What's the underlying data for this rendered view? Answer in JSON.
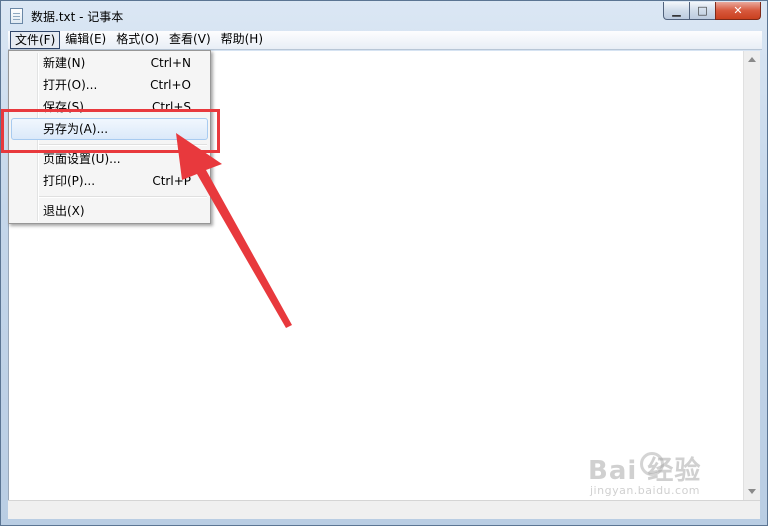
{
  "window": {
    "title": "数据.txt - 记事本",
    "buttons": {
      "minimize_glyph": "▁",
      "maximize_glyph": "□",
      "close_glyph": "✕"
    }
  },
  "menubar": {
    "items": [
      {
        "label": "文件(F)"
      },
      {
        "label": "编辑(E)"
      },
      {
        "label": "格式(O)"
      },
      {
        "label": "查看(V)"
      },
      {
        "label": "帮助(H)"
      }
    ]
  },
  "file_menu": {
    "items": [
      {
        "label": "新建(N)",
        "shortcut": "Ctrl+N"
      },
      {
        "label": "打开(O)...",
        "shortcut": "Ctrl+O"
      },
      {
        "label": "保存(S)",
        "shortcut": "Ctrl+S"
      },
      {
        "label": "另存为(A)...",
        "shortcut": "",
        "highlighted": true
      },
      {
        "label": "页面设置(U)...",
        "shortcut": ""
      },
      {
        "label": "打印(P)...",
        "shortcut": "Ctrl+P"
      },
      {
        "label": "退出(X)",
        "shortcut": ""
      }
    ]
  },
  "annotation": {
    "box_color": "#e8393d",
    "arrow_color": "#e8393d"
  },
  "watermark": {
    "main": "Bai  经验",
    "sub": "jingyan.baidu.com"
  },
  "icons": {
    "app": "notepad-icon",
    "scroll_up": "scroll-up-arrow-icon",
    "scroll_down": "scroll-down-arrow-icon",
    "watermark": "baidu-paw-icon"
  }
}
